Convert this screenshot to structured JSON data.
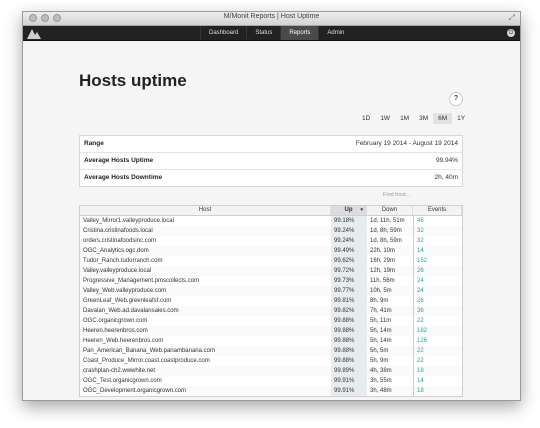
{
  "window": {
    "title": "M/Monit Reports | Host Uptime"
  },
  "nav": {
    "tabs": [
      "Dashboard",
      "Status",
      "Reports",
      "Admin"
    ],
    "active": "Reports"
  },
  "page": {
    "title": "Hosts uptime",
    "help": "?"
  },
  "ranges": {
    "options": [
      "1D",
      "1W",
      "1M",
      "3M",
      "6M",
      "1Y"
    ],
    "active": "6M"
  },
  "summary": [
    {
      "label": "Range",
      "value": "February 19 2014 - August 19 2014"
    },
    {
      "label": "Average Hosts Uptime",
      "value": "99.94%"
    },
    {
      "label": "Average Hosts Downtime",
      "value": "2h, 40m"
    }
  ],
  "find": {
    "placeholder": "Find host..."
  },
  "table": {
    "headers": [
      "Host",
      "Up",
      "Down",
      "Events"
    ],
    "sort_indicator": "▾",
    "rows": [
      [
        "Valley_Mirror1.valleyproduce.local",
        "99.18%",
        "1d, 11h, 51m",
        "48"
      ],
      [
        "Cristina.cristinafoods.local",
        "99.24%",
        "1d, 8h, 59m",
        "32"
      ],
      [
        "orders.cristinafoodsinc.com",
        "99.24%",
        "1d, 8h, 59m",
        "32"
      ],
      [
        "OGC_Analytics.ogc.dom",
        "99.49%",
        "22h, 10m",
        "14"
      ],
      [
        "Tudor_Ranch.tudorranch.com",
        "99.62%",
        "16h, 29m",
        "152"
      ],
      [
        "Valley.valleyproduce.local",
        "99.72%",
        "12h, 19m",
        "26"
      ],
      [
        "Progressive_Management.pmscollects.com",
        "99.73%",
        "11h, 56m",
        "24"
      ],
      [
        "Valley_Web.valleyproduce.com",
        "99.77%",
        "10h, 5m",
        "24"
      ],
      [
        "GreenLeaf_Web.greenleafsf.com",
        "99.81%",
        "8h, 9m",
        "26"
      ],
      [
        "Davalan_Web.ad.davalansales.com",
        "99.82%",
        "7h, 41m",
        "36"
      ],
      [
        "OGC.organicgrown.com",
        "99.88%",
        "5h, 11m",
        "22"
      ],
      [
        "Heeren.heerenbros.com",
        "99.88%",
        "5h, 14m",
        "182"
      ],
      [
        "Heeren_Web.heerenbros.com",
        "99.88%",
        "5h, 14m",
        "126"
      ],
      [
        "Pan_American_Banana_Web.panambanana.com",
        "99.88%",
        "5h, 5m",
        "22"
      ],
      [
        "Coast_Produce_Mirror.coast.coastproduce.com",
        "99.88%",
        "5h, 9m",
        "22"
      ],
      [
        "crashplan-ch2.wwwhite.net",
        "99.89%",
        "4h, 38m",
        "18"
      ],
      [
        "OGC_Test.organicgrown.com",
        "99.91%",
        "3h, 55m",
        "14"
      ],
      [
        "OGC_Development.organicgrown.com",
        "99.91%",
        "3h, 48m",
        "18"
      ]
    ]
  }
}
